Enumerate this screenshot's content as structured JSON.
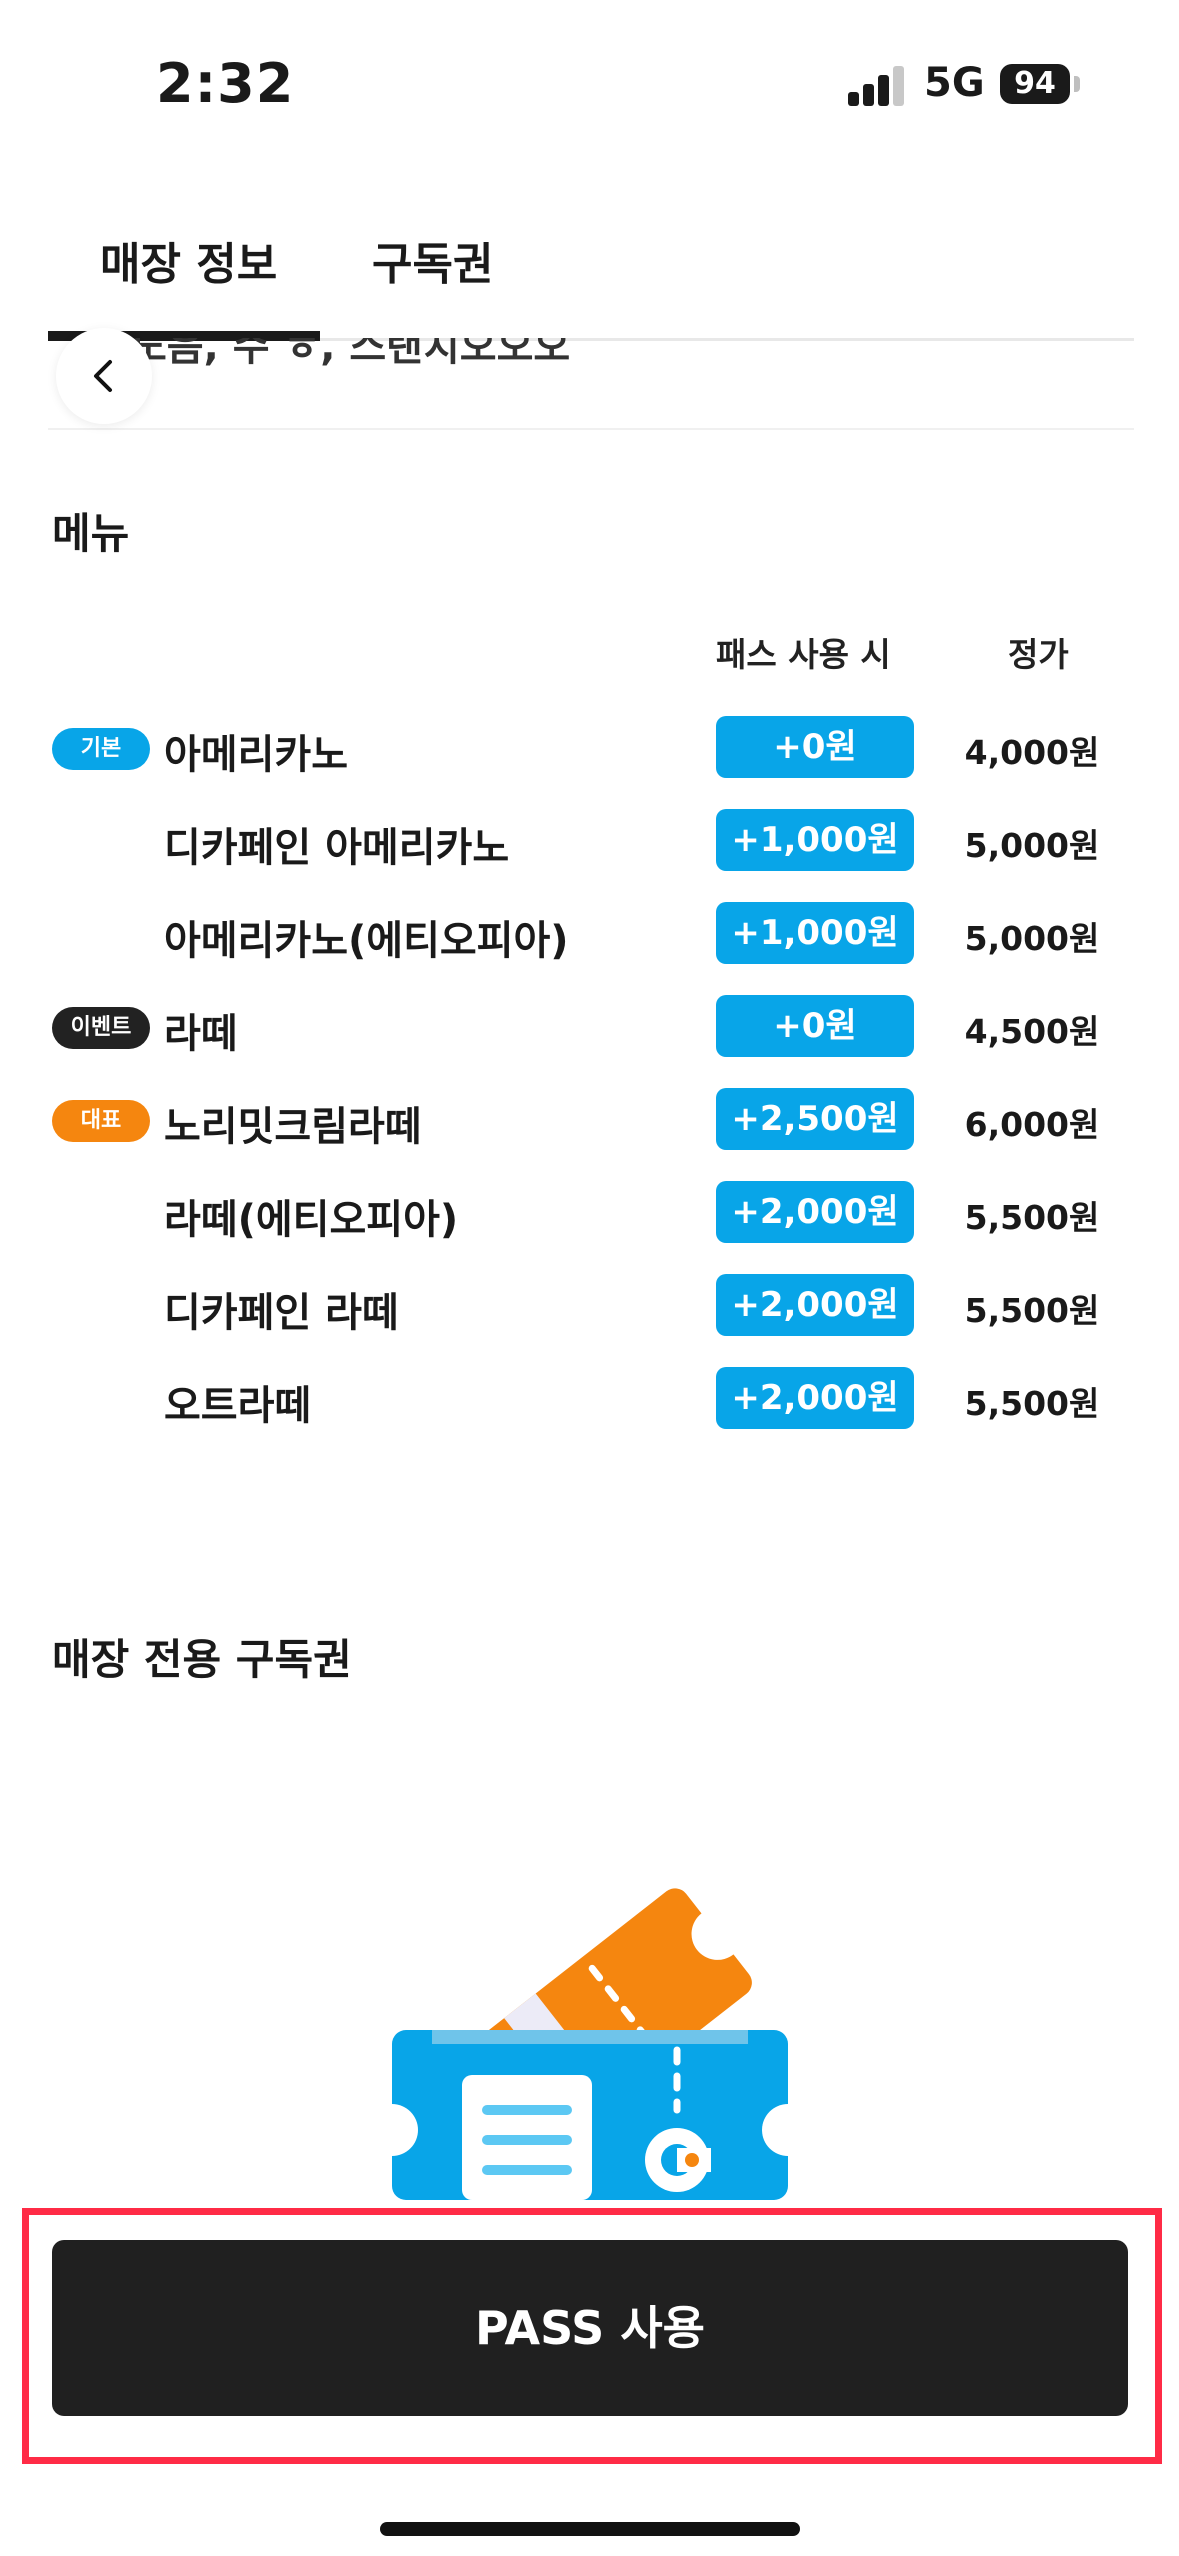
{
  "status_bar": {
    "time": "2:32",
    "network": "5G",
    "battery": "94"
  },
  "tabs": [
    {
      "label": "매장 정보",
      "active": true
    },
    {
      "label": "구독권",
      "active": false
    }
  ],
  "partial_text": "노음, 수 ㅎ, 스탠치오오오",
  "menu": {
    "title": "메뉴",
    "col_pass": "패스 사용 시",
    "col_price": "정가",
    "items": [
      {
        "badge": "기본",
        "badge_color": "#08a5e8",
        "name": "아메리카노",
        "pass": "+0원",
        "price": "4,000원"
      },
      {
        "badge": "",
        "name": "디카페인 아메리카노",
        "pass": "+1,000원",
        "price": "5,000원"
      },
      {
        "badge": "",
        "name": "아메리카노(에티오피아)",
        "pass": "+1,000원",
        "price": "5,000원"
      },
      {
        "badge": "이벤트",
        "badge_color": "#222222",
        "name": "라떼",
        "pass": "+0원",
        "price": "4,500원"
      },
      {
        "badge": "대표",
        "badge_color": "#f5860f",
        "name": "노리밋크림라떼",
        "pass": "+2,500원",
        "price": "6,000원"
      },
      {
        "badge": "",
        "name": "라떼(에티오피아)",
        "pass": "+2,000원",
        "price": "5,500원"
      },
      {
        "badge": "",
        "name": "디카페인 라떼",
        "pass": "+2,000원",
        "price": "5,500원"
      },
      {
        "badge": "",
        "name": "오트라떼",
        "pass": "+2,000원",
        "price": "5,500원"
      }
    ]
  },
  "subscription": {
    "title": "매장 전용 구독권",
    "illustration": "ticket-illustration"
  },
  "cta": {
    "label": "PASS 사용"
  },
  "colors": {
    "accent": "#08a5e8",
    "orange": "#f5860f",
    "dark": "#202020",
    "highlight": "#ff2b46"
  }
}
